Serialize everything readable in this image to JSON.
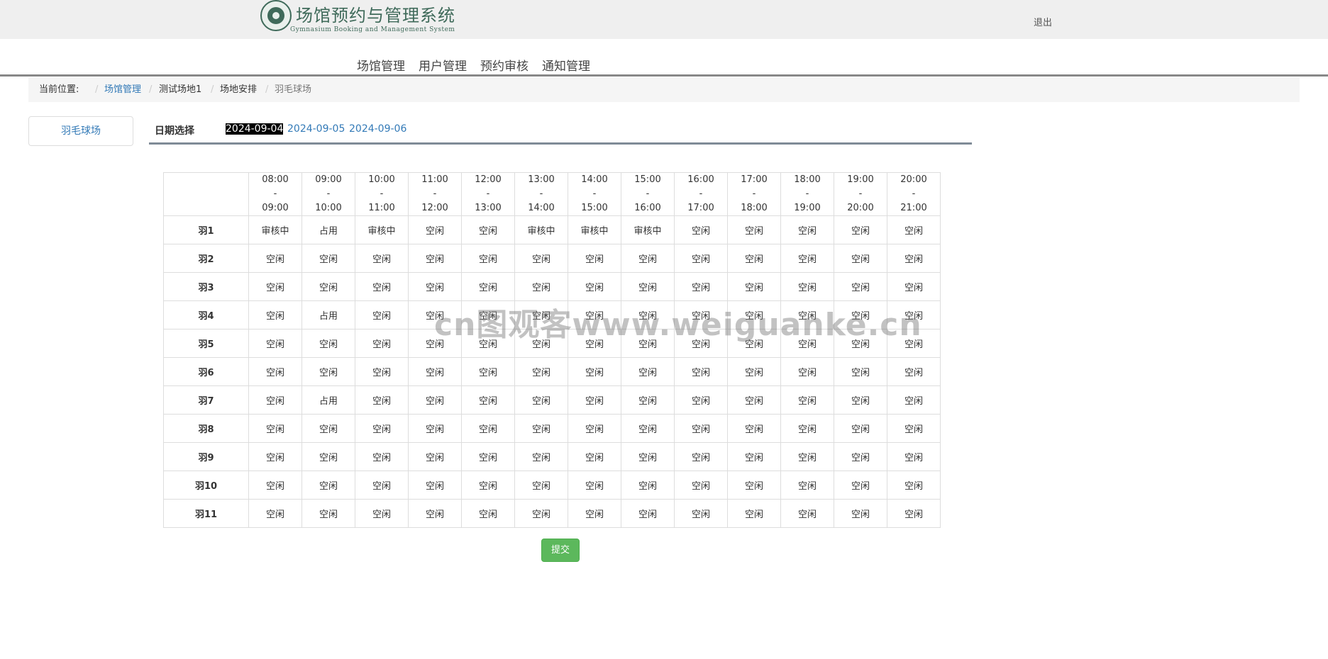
{
  "header": {
    "logo_title": "场馆预约与管理系统",
    "logo_subtitle": "Gymnasium Booking and Management System",
    "logout_label": "退出"
  },
  "nav": {
    "items": [
      {
        "label": "场馆管理"
      },
      {
        "label": "用户管理"
      },
      {
        "label": "预约审核"
      },
      {
        "label": "通知管理"
      }
    ]
  },
  "breadcrumb": {
    "prefix": "当前位置:",
    "items": [
      {
        "label": "场馆管理"
      },
      {
        "label": "测试场地1"
      },
      {
        "label": "场地安排"
      },
      {
        "label": "羽毛球场"
      }
    ]
  },
  "sidebar": {
    "venue_label": "羽毛球场"
  },
  "date_selector": {
    "label": "日期选择",
    "options": [
      "2024-09-04",
      "2024-09-05",
      "2024-09-06"
    ],
    "selected": "2024-09-04"
  },
  "schedule": {
    "time_slots": [
      {
        "start": "08:00",
        "sep": "-",
        "end": "09:00"
      },
      {
        "start": "09:00",
        "sep": "-",
        "end": "10:00"
      },
      {
        "start": "10:00",
        "sep": "-",
        "end": "11:00"
      },
      {
        "start": "11:00",
        "sep": "-",
        "end": "12:00"
      },
      {
        "start": "12:00",
        "sep": "-",
        "end": "13:00"
      },
      {
        "start": "13:00",
        "sep": "-",
        "end": "14:00"
      },
      {
        "start": "14:00",
        "sep": "-",
        "end": "15:00"
      },
      {
        "start": "15:00",
        "sep": "-",
        "end": "16:00"
      },
      {
        "start": "16:00",
        "sep": "-",
        "end": "17:00"
      },
      {
        "start": "17:00",
        "sep": "-",
        "end": "18:00"
      },
      {
        "start": "18:00",
        "sep": "-",
        "end": "19:00"
      },
      {
        "start": "19:00",
        "sep": "-",
        "end": "20:00"
      },
      {
        "start": "20:00",
        "sep": "-",
        "end": "21:00"
      }
    ],
    "courts": [
      {
        "name": "羽1",
        "cells": [
          "审核中",
          "占用",
          "审核中",
          "空闲",
          "空闲",
          "审核中",
          "审核中",
          "审核中",
          "空闲",
          "空闲",
          "空闲",
          "空闲",
          "空闲"
        ]
      },
      {
        "name": "羽2",
        "cells": [
          "空闲",
          "空闲",
          "空闲",
          "空闲",
          "空闲",
          "空闲",
          "空闲",
          "空闲",
          "空闲",
          "空闲",
          "空闲",
          "空闲",
          "空闲"
        ]
      },
      {
        "name": "羽3",
        "cells": [
          "空闲",
          "空闲",
          "空闲",
          "空闲",
          "空闲",
          "空闲",
          "空闲",
          "空闲",
          "空闲",
          "空闲",
          "空闲",
          "空闲",
          "空闲"
        ]
      },
      {
        "name": "羽4",
        "cells": [
          "空闲",
          "占用",
          "空闲",
          "空闲",
          "空闲",
          "空闲",
          "空闲",
          "空闲",
          "空闲",
          "空闲",
          "空闲",
          "空闲",
          "空闲"
        ]
      },
      {
        "name": "羽5",
        "cells": [
          "空闲",
          "空闲",
          "空闲",
          "空闲",
          "空闲",
          "空闲",
          "空闲",
          "空闲",
          "空闲",
          "空闲",
          "空闲",
          "空闲",
          "空闲"
        ]
      },
      {
        "name": "羽6",
        "cells": [
          "空闲",
          "空闲",
          "空闲",
          "空闲",
          "空闲",
          "空闲",
          "空闲",
          "空闲",
          "空闲",
          "空闲",
          "空闲",
          "空闲",
          "空闲"
        ]
      },
      {
        "name": "羽7",
        "cells": [
          "空闲",
          "占用",
          "空闲",
          "空闲",
          "空闲",
          "空闲",
          "空闲",
          "空闲",
          "空闲",
          "空闲",
          "空闲",
          "空闲",
          "空闲"
        ]
      },
      {
        "name": "羽8",
        "cells": [
          "空闲",
          "空闲",
          "空闲",
          "空闲",
          "空闲",
          "空闲",
          "空闲",
          "空闲",
          "空闲",
          "空闲",
          "空闲",
          "空闲",
          "空闲"
        ]
      },
      {
        "name": "羽9",
        "cells": [
          "空闲",
          "空闲",
          "空闲",
          "空闲",
          "空闲",
          "空闲",
          "空闲",
          "空闲",
          "空闲",
          "空闲",
          "空闲",
          "空闲",
          "空闲"
        ]
      },
      {
        "name": "羽10",
        "cells": [
          "空闲",
          "空闲",
          "空闲",
          "空闲",
          "空闲",
          "空闲",
          "空闲",
          "空闲",
          "空闲",
          "空闲",
          "空闲",
          "空闲",
          "空闲"
        ]
      },
      {
        "name": "羽11",
        "cells": [
          "空闲",
          "空闲",
          "空闲",
          "空闲",
          "空闲",
          "空闲",
          "空闲",
          "空闲",
          "空闲",
          "空闲",
          "空闲",
          "空闲",
          "空闲"
        ]
      }
    ]
  },
  "submit_label": "提交",
  "watermark": "cn图观客www.weiguanke.cn"
}
